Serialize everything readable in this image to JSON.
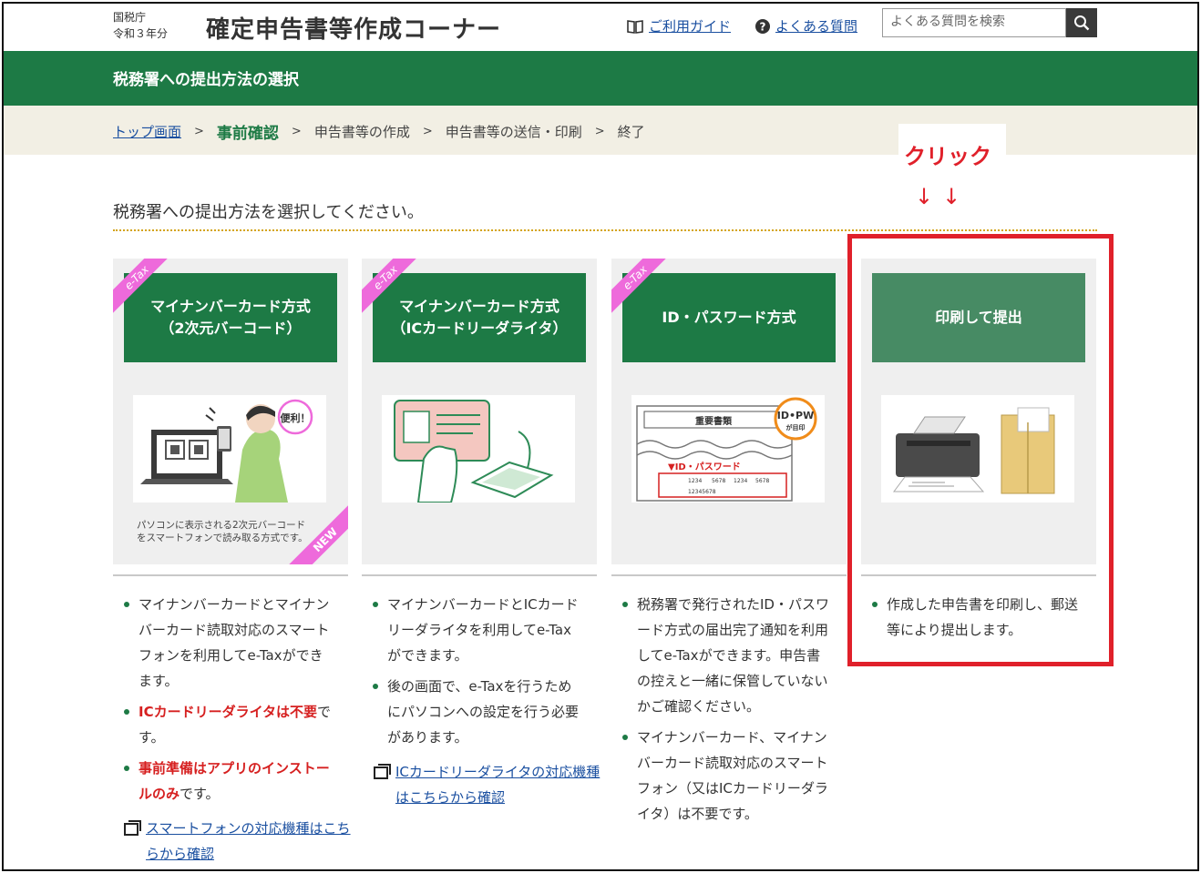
{
  "header": {
    "agency": "国税庁",
    "year": "令和３年分",
    "app_title": "確定申告書等作成コーナー",
    "guide_link": "ご利用ガイド",
    "faq_link": "よくある質問",
    "search_placeholder": "よくある質問を検索"
  },
  "section_bar": {
    "title": "税務署への提出方法の選択"
  },
  "breadcrumb": {
    "items": [
      "トップ画面",
      "事前確認",
      "申告書等の作成",
      "申告書等の送信・印刷",
      "終了"
    ]
  },
  "annotation": {
    "click_label": "クリック",
    "arrows": "↓↓"
  },
  "instruction": "税務署への提出方法を選択してください。",
  "cards": [
    {
      "ribbon": "e-Tax",
      "title_line1": "マイナンバーカード方式",
      "title_line2": "（2次元バーコード）",
      "bubble": "便利！",
      "caption_line1": "パソコンに表示される2次元バーコード",
      "caption_line2": "をスマートフォンで読み取る方式です。",
      "new_tag": "NEW",
      "bullets": [
        "マイナンバーカードとマイナンバーカード読取対応のスマートフォンを利用してe-Taxができます。"
      ],
      "red_bullets": [
        {
          "strong": "ICカードリーダライタは不要",
          "tail": "です。"
        },
        {
          "strong": "事前準備はアプリのインストールのみ",
          "tail": "です。"
        }
      ],
      "link": "スマートフォンの対応機種はこちらから確認"
    },
    {
      "ribbon": "e-Tax",
      "title_line1": "マイナンバーカード方式",
      "title_line2": "（ICカードリーダライタ）",
      "bullets": [
        "マイナンバーカードとICカードリーダライタを利用してe-Taxができます。",
        "後の画面で、e-Taxを行うためにパソコンへの設定を行う必要があります。"
      ],
      "link": "ICカードリーダライタの対応機種はこちらから確認"
    },
    {
      "ribbon": "e-Tax",
      "title_line1": "ID・パスワード方式",
      "illus_doc_title": "重要書類",
      "illus_idpw": "ID•PW",
      "illus_mark": "が目印",
      "illus_label": "▼ID・パスワード",
      "illus_codes": [
        "1234",
        "5678",
        "1234",
        "5678"
      ],
      "illus_num": "12345678",
      "bullets": [
        "税務署で発行されたID・パスワード方式の届出完了通知を利用してe-Taxができます。申告書の控えと一緒に保管していないかご確認ください。",
        "マイナンバーカード、マイナンバーカード読取対応のスマートフォン（又はICカードリーダライタ）は不要です。"
      ]
    },
    {
      "title_line1": "印刷して提出",
      "bullets": [
        "作成した申告書を印刷し、郵送等により提出します。"
      ]
    }
  ],
  "colors": {
    "green": "#1d7a45",
    "red": "#e0202a",
    "pink": "#ee6adb",
    "link": "#1a4fa0"
  }
}
